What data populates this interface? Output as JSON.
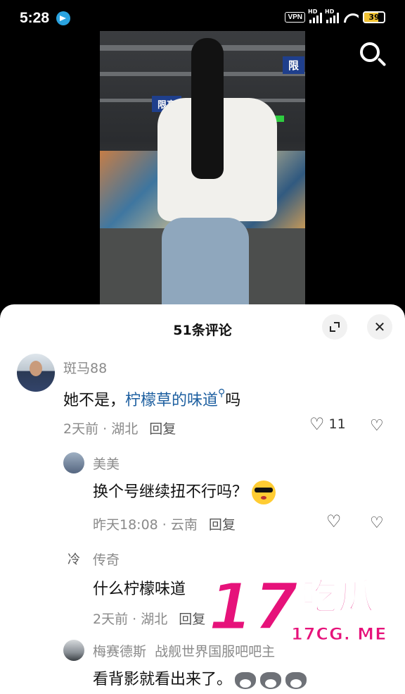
{
  "status_bar": {
    "time": "5:28",
    "vpn": "VPN",
    "hd1": "HD",
    "hd2": "HD",
    "battery": "39"
  },
  "video": {
    "sign_text_1": "限",
    "sign_text_2": "限高"
  },
  "sheet": {
    "title": "51条评论",
    "expand_icon": "expand-icon",
    "close_icon": "close-icon",
    "close_glyph": "✕"
  },
  "comments": [
    {
      "user": "斑马88",
      "text_before": "她不是，",
      "text_link": "柠檬草的味道",
      "text_after": "吗",
      "time": "2天前",
      "location": "湖北",
      "reply": "回复",
      "likes": "11"
    },
    {
      "user": "美美",
      "text": "换个号继续扭不行吗？",
      "time": "昨天18:08",
      "location": "云南",
      "reply": "回复"
    },
    {
      "user": "传奇",
      "avatar_text": "冷",
      "text": "什么柠檬味道",
      "time": "2天前",
      "location": "湖北",
      "reply": "回复"
    },
    {
      "user": "梅赛德斯",
      "badge": "战舰世界国服吧吧主",
      "text": "看背影就看出来了。"
    }
  ],
  "meta_sep": " · ",
  "watermark": {
    "number": "17",
    "chinese": "吃瓜",
    "domain": "17CG. ME"
  }
}
